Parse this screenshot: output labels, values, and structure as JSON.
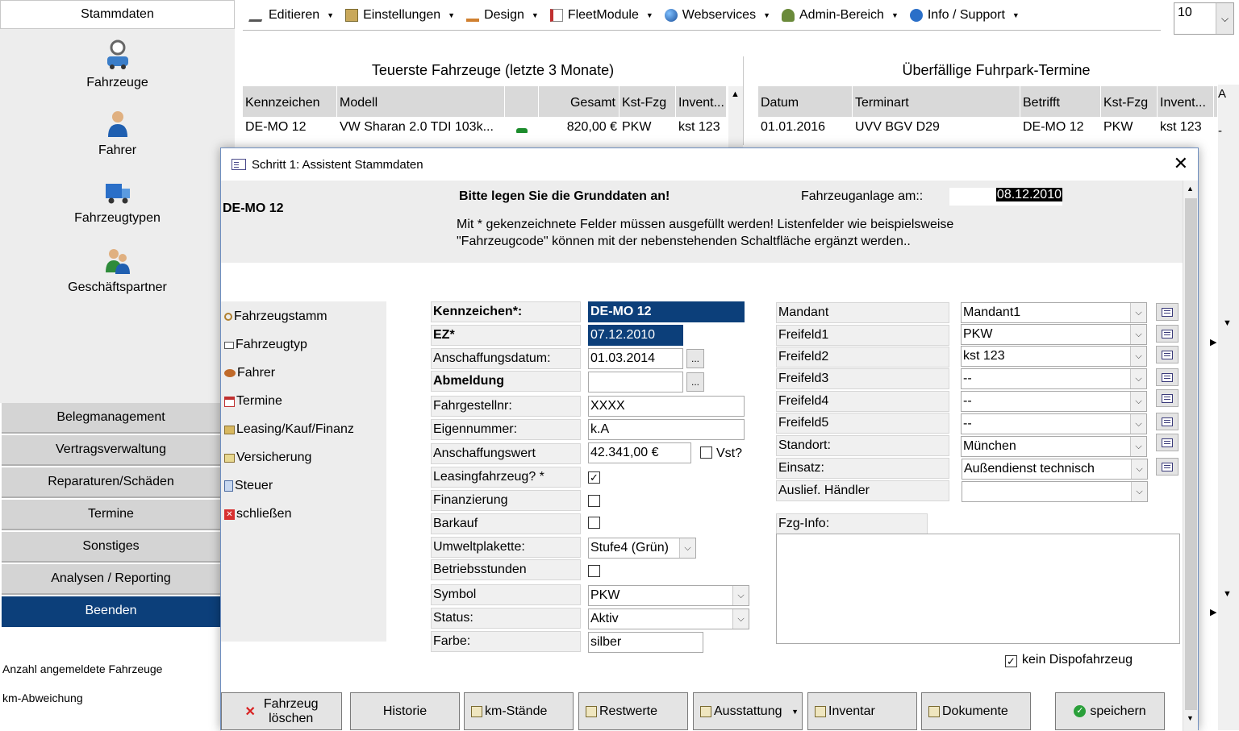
{
  "left_nav": {
    "tab_label": "Stammdaten",
    "icon_items": [
      {
        "label": "Fahrzeuge",
        "icon": "car-search-icon"
      },
      {
        "label": "Fahrer",
        "icon": "driver-person-icon"
      },
      {
        "label": "Fahrzeugtypen",
        "icon": "truck-icon"
      },
      {
        "label": "Geschäftspartner",
        "icon": "business-partner-icon"
      }
    ],
    "categories": [
      {
        "label": "Belegmanagement",
        "active": false
      },
      {
        "label": "Vertragsverwaltung",
        "active": false
      },
      {
        "label": "Reparaturen/Schäden",
        "active": false
      },
      {
        "label": "Termine",
        "active": false
      },
      {
        "label": "Sonstiges",
        "active": false
      },
      {
        "label": "Analysen / Reporting",
        "active": false
      },
      {
        "label": "Beenden",
        "active": true
      }
    ],
    "stats": [
      "Anzahl angemeldete Fahrzeuge",
      "km-Abweichung"
    ]
  },
  "menubar": {
    "items": [
      {
        "label": "Editieren",
        "icon": "edit-icon"
      },
      {
        "label": "Einstellungen",
        "icon": "settings-icon"
      },
      {
        "label": "Design",
        "icon": "design-icon"
      },
      {
        "label": "FleetModule",
        "icon": "module-icon"
      },
      {
        "label": "Webservices",
        "icon": "globe-icon"
      },
      {
        "label": "Admin-Bereich",
        "icon": "admin-icon"
      },
      {
        "label": "Info / Support",
        "icon": "info-icon"
      }
    ],
    "page_size_value": "10"
  },
  "dashboard": {
    "left_panel": {
      "title": "Teuerste Fahrzeuge (letzte 3 Monate)",
      "columns": [
        "Kennzeichen",
        "Modell",
        "",
        "Gesamt",
        "Kst-Fzg",
        "Invent..."
      ],
      "row": [
        "DE-MO 12",
        "VW Sharan 2.0 TDI 103k...",
        "",
        "820,00 €",
        "PKW",
        "kst 123"
      ]
    },
    "right_panel": {
      "title": "Überfällige Fuhrpark-Termine",
      "columns": [
        "Datum",
        "Terminart",
        "Betrifft",
        "Kst-Fzg",
        "Invent...",
        "A"
      ],
      "row": [
        "01.01.2016",
        "UVV BGV D29",
        "DE-MO 12",
        "PKW",
        "kst 123",
        "-"
      ]
    }
  },
  "dialog": {
    "title": "Schritt 1: Assistent Stammdaten",
    "plate": "DE-MO 12",
    "heading": "Bitte legen Sie die Grunddaten an!",
    "created_label": "Fahrzeuganlage am::",
    "created_value": "08.12.2010",
    "hint_line1": "Mit * gekenzeichnete Felder müssen ausgefüllt werden! Listenfelder wie beispielsweise",
    "hint_line2": "\"Fahrzeugcode\" können mit der nebenstehenden Schaltfläche ergänzt werden..",
    "side_links": [
      {
        "label": "Fahrzeugstamm",
        "icon": "key-icon"
      },
      {
        "label": "Fahrzeugtyp",
        "icon": "edit-pencil-icon"
      },
      {
        "label": "Fahrer",
        "icon": "people-icon"
      },
      {
        "label": "Termine",
        "icon": "calendar-icon"
      },
      {
        "label": "Leasing/Kauf/Finanz",
        "icon": "folder-icon"
      },
      {
        "label": "Versicherung",
        "icon": "document-icon"
      },
      {
        "label": "Steuer",
        "icon": "notepad-icon"
      },
      {
        "label": "schließen",
        "icon": "close-red-icon"
      }
    ],
    "left_form": {
      "kennzeichen": {
        "label": "Kennzeichen*:",
        "value": "DE-MO 12"
      },
      "ez": {
        "label": "EZ*",
        "value": "07.12.2010"
      },
      "anschaffungsdatum": {
        "label": "Anschaffungsdatum:",
        "value": "01.03.2014"
      },
      "abmeldung": {
        "label": "Abmeldung",
        "value": ""
      },
      "fahrgestellnr": {
        "label": "Fahrgestellnr:",
        "value": "XXXX"
      },
      "eigennummer": {
        "label": "Eigennummer:",
        "value": "k.A"
      },
      "anschaffungswert": {
        "label": "Anschaffungswert",
        "value": "42.341,00 €",
        "vst_label": "Vst?",
        "vst_checked": false
      },
      "leasingfahrzeug": {
        "label": "Leasingfahrzeug? *",
        "checked": true
      },
      "finanzierung": {
        "label": "Finanzierung",
        "checked": false
      },
      "barkauf": {
        "label": "Barkauf",
        "checked": false
      },
      "umweltplakette": {
        "label": "Umweltplakette:",
        "value": "Stufe4 (Grün)"
      },
      "betriebsstunden": {
        "label": "Betriebsstunden",
        "checked": false
      },
      "symbol": {
        "label": "Symbol",
        "value": "PKW"
      },
      "status": {
        "label": "Status:",
        "value": "Aktiv"
      },
      "farbe": {
        "label": "Farbe:",
        "value": "silber"
      }
    },
    "right_form": {
      "rows": [
        {
          "label": "Mandant",
          "value": "Mandant1",
          "button": true
        },
        {
          "label": "Freifeld1",
          "value": "PKW",
          "button": true
        },
        {
          "label": "Freifeld2",
          "value": "kst 123",
          "button": true
        },
        {
          "label": "Freifeld3",
          "value": "--",
          "button": true
        },
        {
          "label": "Freifeld4",
          "value": "--",
          "button": true
        },
        {
          "label": "Freifeld5",
          "value": "--",
          "button": true
        },
        {
          "label": "Standort:",
          "value": "München",
          "button": true
        },
        {
          "label": "Einsatz:",
          "value": "Außendienst technisch",
          "button": true
        },
        {
          "label": "Auslief. Händler",
          "value": "",
          "button": false
        }
      ],
      "info_label": "Fzg-Info:",
      "info_value": "",
      "dispo_label": "kein Dispofahrzeug",
      "dispo_checked": true
    },
    "buttons": {
      "delete_line1": "Fahrzeug",
      "delete_line2": "löschen",
      "historie": "Historie",
      "km": "km-Stände",
      "restwerte": "Restwerte",
      "ausstattung": "Ausstattung",
      "inventar": "Inventar",
      "dokumente": "Dokumente",
      "speichern": "speichern"
    }
  }
}
